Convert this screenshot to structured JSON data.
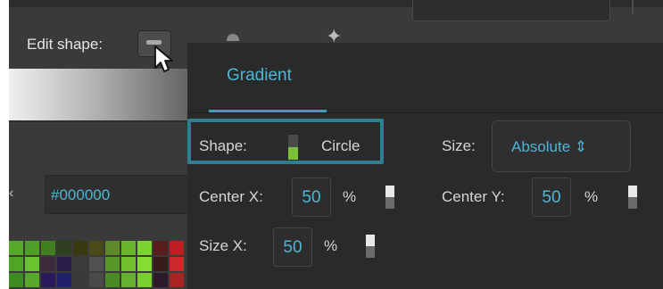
{
  "toolbar": {
    "edit_shape_label": "Edit shape:",
    "edit_shape_icon": "rectangle-shape-icon",
    "cursor_icon": "mouse-pointer-icon"
  },
  "color_section": {
    "hex_value": "#000000",
    "palette": [
      "#5aa82a",
      "#4f9e27",
      "#3f7f1f",
      "#2f3f1f",
      "#3a3a10",
      "#4a4a18",
      "#5f8a2a",
      "#6ab52e",
      "#7fd32e",
      "#5a1c1c",
      "#bb2020",
      "#3a3a3a",
      "#4fa526",
      "#69c32f",
      "#3a2a3a",
      "#2a1f4a",
      "#3c3c3c",
      "#505050",
      "#58962a",
      "#72c02f",
      "#86dc33",
      "#3a1a1a",
      "#cc2a2a",
      "#3a3a3a",
      "#3f8a22",
      "#5aa82a",
      "#2a1a5a",
      "#1f1f6a",
      "#3a3a3a",
      "#4a4a4a",
      "#4a8a24",
      "#65b02c",
      "#7ace30",
      "#2a1a2a",
      "#aa2222",
      "#3a3a3a"
    ]
  },
  "gradient_panel": {
    "tab_label": "Gradient",
    "shape_label": "Shape:",
    "shape_value": "Circle",
    "size_label": "Size:",
    "size_mode": "Absolute",
    "size_mode_icon": "up-down-arrows-icon",
    "center_x_label": "Center X:",
    "center_x_value": "50",
    "center_y_label": "Center Y:",
    "center_y_value": "50",
    "size_x_label": "Size X:",
    "size_x_value": "50",
    "percent": "%"
  },
  "colors": {
    "accent": "#4db6d6",
    "highlight_border": "#2f7f93",
    "shape_toggle_active": "#7bbf3a"
  }
}
